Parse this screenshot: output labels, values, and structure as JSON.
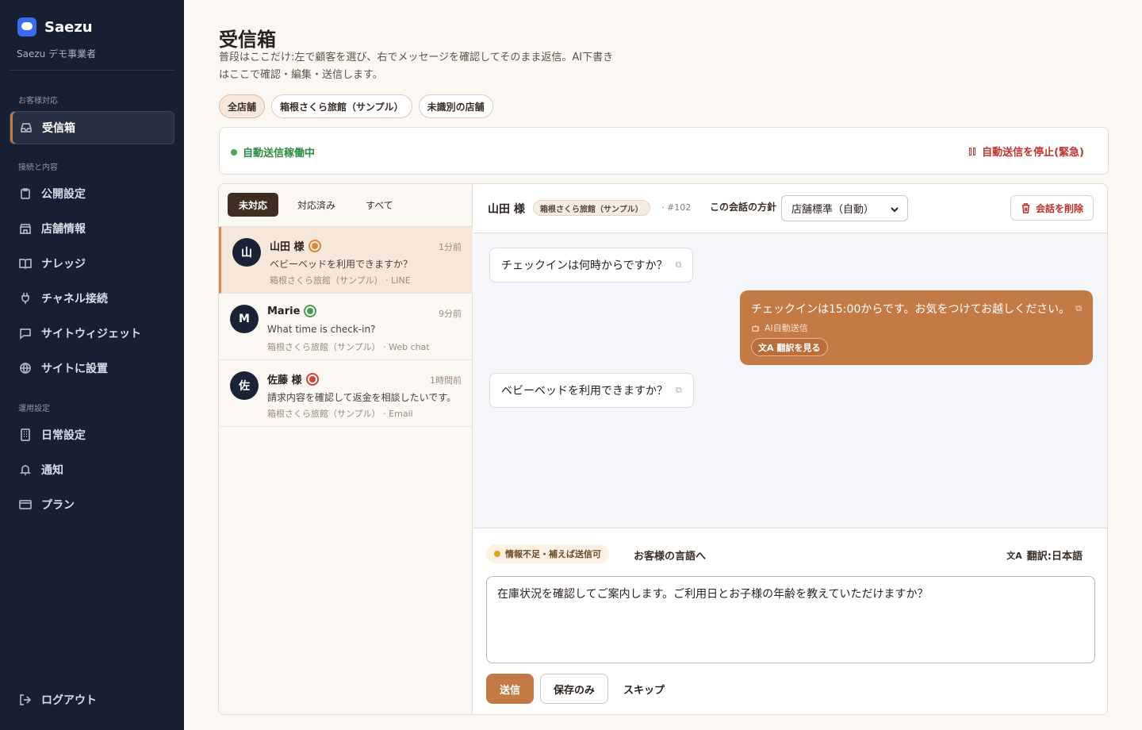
{
  "app": {
    "name": "Saezu",
    "org": "Saezu デモ事業者"
  },
  "sidebar": {
    "sections": {
      "support": "お客様対応",
      "connect": "接続と内容",
      "ops": "運用設定"
    },
    "items": [
      {
        "label": "受信箱",
        "icon": "inbox-icon"
      },
      {
        "label": "公開設定",
        "icon": "clipboard-icon"
      },
      {
        "label": "店舗情報",
        "icon": "store-icon"
      },
      {
        "label": "ナレッジ",
        "icon": "book-icon"
      },
      {
        "label": "チャネル接続",
        "icon": "plug-icon"
      },
      {
        "label": "サイトウィジェット",
        "icon": "chat-icon"
      },
      {
        "label": "サイトに設置",
        "icon": "globe-icon"
      },
      {
        "label": "日常設定",
        "icon": "building-icon"
      },
      {
        "label": "通知",
        "icon": "bell-icon"
      },
      {
        "label": "プラン",
        "icon": "card-icon"
      }
    ],
    "logout": "ログアウト"
  },
  "page": {
    "title": "受信箱",
    "description": "普段はここだけ:左で顧客を選び、右でメッセージを確認してそのまま返信。AI下書きはここで確認・編集・送信します。",
    "filters": [
      "全店舗",
      "箱根さくら旅館（サンプル）",
      "未識別の店舗"
    ]
  },
  "auto": {
    "status": "自動送信稼働中",
    "stop": "自動送信を停止(緊急)",
    "status_color": "#2d8a45"
  },
  "list": {
    "tabs": [
      "未対応",
      "対応済み",
      "すべて"
    ],
    "conversations": [
      {
        "initial": "山",
        "name": "山田 様",
        "time": "1分前",
        "message": "ベビーベッドを利用できますか？",
        "meta": "箱根さくら旅館（サンプル） · LINE",
        "badge_color": "#d28a3c"
      },
      {
        "initial": "M",
        "name": "Marie",
        "time": "9分前",
        "message": "What time is check-in?",
        "meta": "箱根さくら旅館（サンプル） · Web chat",
        "badge_color": "#4a9a55"
      },
      {
        "initial": "佐",
        "name": "佐藤 様",
        "time": "1時間前",
        "message": "請求内容を確認して返金を相談したいです。",
        "meta": "箱根さくら旅館（サンプル） · Email",
        "badge_color": "#d0443c"
      }
    ]
  },
  "chat": {
    "customer": "山田 様",
    "store": "箱根さくら旅館（サンプル）",
    "id": "· #102",
    "policy_label": "この会話の方針",
    "policy_value": "店舗標準（自動）",
    "delete": "会話を削除",
    "messages": [
      {
        "dir": "in",
        "text": "チェックインは何時からですか？"
      },
      {
        "dir": "out",
        "text": "チェックインは15:00からです。お気をつけてお越しください。",
        "tag": "AI自動送信",
        "translate": "翻訳を見る"
      },
      {
        "dir": "in",
        "text": "ベビーベッドを利用できますか？"
      }
    ]
  },
  "composer": {
    "warning": "情報不足・補えば送信可",
    "lang_tab": "お客様の言語へ",
    "translate": "翻訳:日本語",
    "draft": "在庫状況を確認してご案内します。ご利用日とお子様の年齢を教えていただけますか？",
    "send": "送信",
    "save": "保存のみ",
    "skip": "スキップ"
  },
  "colors": {
    "accent": "#c47a45",
    "sidebar": "#172033",
    "danger": "#c2332d"
  }
}
